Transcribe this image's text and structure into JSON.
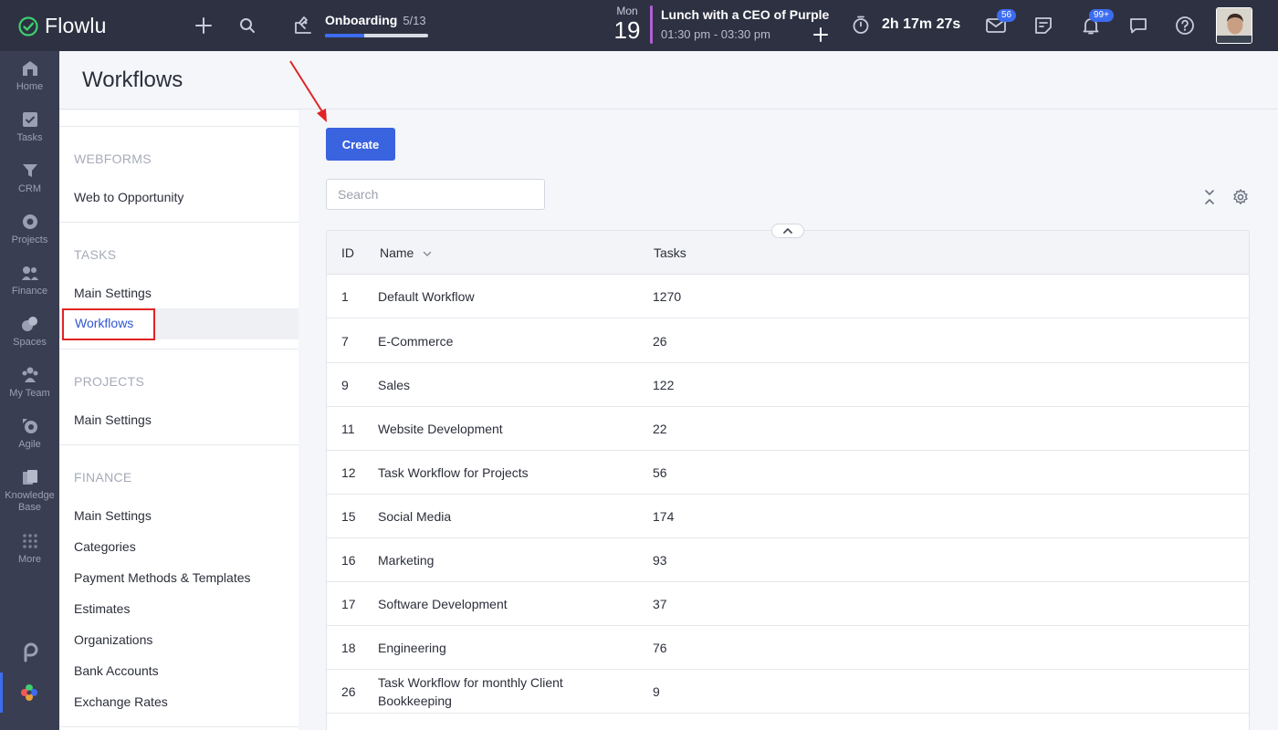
{
  "app": {
    "name": "Flowlu",
    "brand_color": "#3c6cf0",
    "topbar_color": "#2d3142"
  },
  "topbar": {
    "add_icon": "plus-icon",
    "search_icon": "search-icon",
    "onboarding": {
      "label": "Onboarding",
      "count": "5/13",
      "progress": 0.38
    },
    "calendar": {
      "weekday": "Mon",
      "day": "19",
      "event_title": "Lunch with a CEO of Purple",
      "event_time": "01:30 pm - 03:30 pm"
    },
    "timer": "2h 17m 27s",
    "mail_badge": "56",
    "notifications_badge": "99+"
  },
  "leftnav": {
    "items": [
      {
        "label": "Home",
        "icon": "home-icon"
      },
      {
        "label": "Tasks",
        "icon": "tasks-icon"
      },
      {
        "label": "CRM",
        "icon": "crm-icon"
      },
      {
        "label": "Projects",
        "icon": "projects-icon"
      },
      {
        "label": "Finance",
        "icon": "finance-icon"
      },
      {
        "label": "Spaces",
        "icon": "spaces-icon"
      },
      {
        "label": "My Team",
        "icon": "team-icon"
      },
      {
        "label": "Agile",
        "icon": "agile-icon"
      },
      {
        "label": "Knowledge Base",
        "icon": "knowledge-base-icon"
      },
      {
        "label": "More",
        "icon": "grid-icon"
      }
    ]
  },
  "page": {
    "title": "Workflows"
  },
  "settings": {
    "webforms": {
      "title": "WEBFORMS",
      "items": [
        "Web to Opportunity"
      ]
    },
    "tasks": {
      "title": "TASKS",
      "items": [
        "Main Settings",
        "Workflows"
      ]
    },
    "projects": {
      "title": "PROJECTS",
      "items": [
        "Main Settings"
      ]
    },
    "finance": {
      "title": "FINANCE",
      "items": [
        "Main Settings",
        "Categories",
        "Payment Methods & Templates",
        "Estimates",
        "Organizations",
        "Bank Accounts",
        "Exchange Rates"
      ]
    }
  },
  "main": {
    "create_label": "Create",
    "search_placeholder": "Search",
    "columns": {
      "id": "ID",
      "name": "Name",
      "tasks": "Tasks"
    },
    "rows": [
      {
        "id": "1",
        "name": "Default Workflow",
        "tasks": "1270"
      },
      {
        "id": "7",
        "name": "E-Commerce",
        "tasks": "26"
      },
      {
        "id": "9",
        "name": "Sales",
        "tasks": "122"
      },
      {
        "id": "11",
        "name": "Website Development",
        "tasks": "22"
      },
      {
        "id": "12",
        "name": "Task Workflow for Projects",
        "tasks": "56"
      },
      {
        "id": "15",
        "name": "Social Media",
        "tasks": "174"
      },
      {
        "id": "16",
        "name": "Marketing",
        "tasks": "93"
      },
      {
        "id": "17",
        "name": "Software Development",
        "tasks": "37"
      },
      {
        "id": "18",
        "name": "Engineering",
        "tasks": "76"
      },
      {
        "id": "26",
        "name": "Task Workflow for monthly Client Bookkeeping",
        "tasks": "9"
      }
    ]
  }
}
